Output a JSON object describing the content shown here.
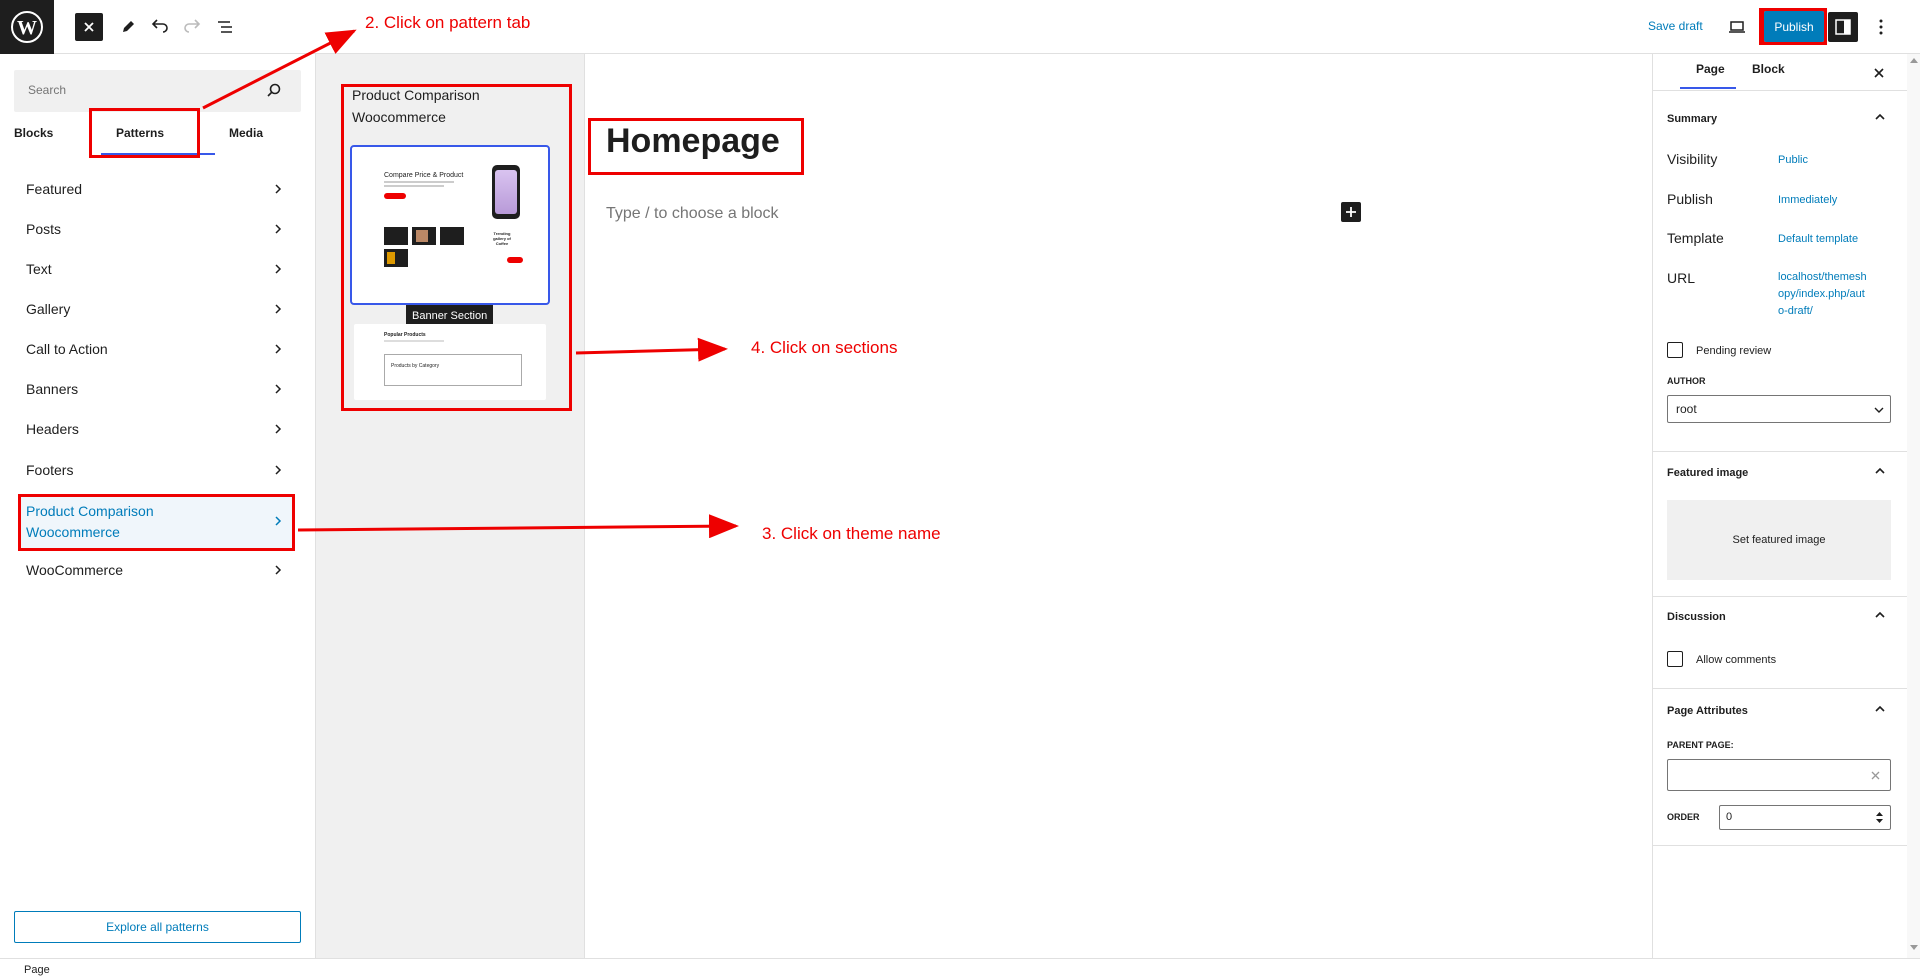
{
  "topbar": {
    "save_draft": "Save draft",
    "publish": "Publish"
  },
  "inserter": {
    "search_placeholder": "Search",
    "tabs": [
      "Blocks",
      "Patterns",
      "Media"
    ],
    "categories": [
      "Featured",
      "Posts",
      "Text",
      "Gallery",
      "Call to Action",
      "Banners",
      "Headers",
      "Footers",
      "Product Comparison Woocommerce",
      "WooCommerce"
    ],
    "active_category_line1": "Product Comparison",
    "active_category_line2": "Woocommerce",
    "explore": "Explore all patterns"
  },
  "pattern_panel": {
    "title": "Product Comparison Woocommerce",
    "pattern1_heading": "Compare Price & Product",
    "pattern1_side": "Trending gallery of Coffee",
    "pattern1_tooltip": "Banner Section",
    "pattern2_heading": "Popular Products",
    "pattern2_inner": "Products by Category"
  },
  "canvas": {
    "title": "Homepage",
    "block_hint": "Type / to choose a block"
  },
  "sidebar": {
    "tabs": [
      "Page",
      "Block"
    ],
    "summary": "Summary",
    "visibility_label": "Visibility",
    "visibility_value": "Public",
    "publish_label": "Publish",
    "publish_value": "Immediately",
    "template_label": "Template",
    "template_value": "Default template",
    "url_label": "URL",
    "url_value_1": "localhost/themesh",
    "url_value_2": "opy/index.php/aut",
    "url_value_3": "o-draft/",
    "pending_review": "Pending review",
    "author_label": "AUTHOR",
    "author_value": "root",
    "featured_image": "Featured image",
    "set_featured_image": "Set featured image",
    "discussion": "Discussion",
    "allow_comments": "Allow comments",
    "page_attributes": "Page Attributes",
    "parent_page": "PARENT PAGE:",
    "order_label": "ORDER",
    "order_value": "0"
  },
  "footer": {
    "breadcrumb": "Page"
  },
  "annotations": {
    "step2": "2. Click on pattern tab",
    "step3": "3. Click on theme name",
    "step4": "4. Click on sections",
    "color": "#ee0000"
  },
  "colors": {
    "accent": "#007cba",
    "tab_indicator": "#3858e9",
    "dark": "#1e1e1e"
  }
}
